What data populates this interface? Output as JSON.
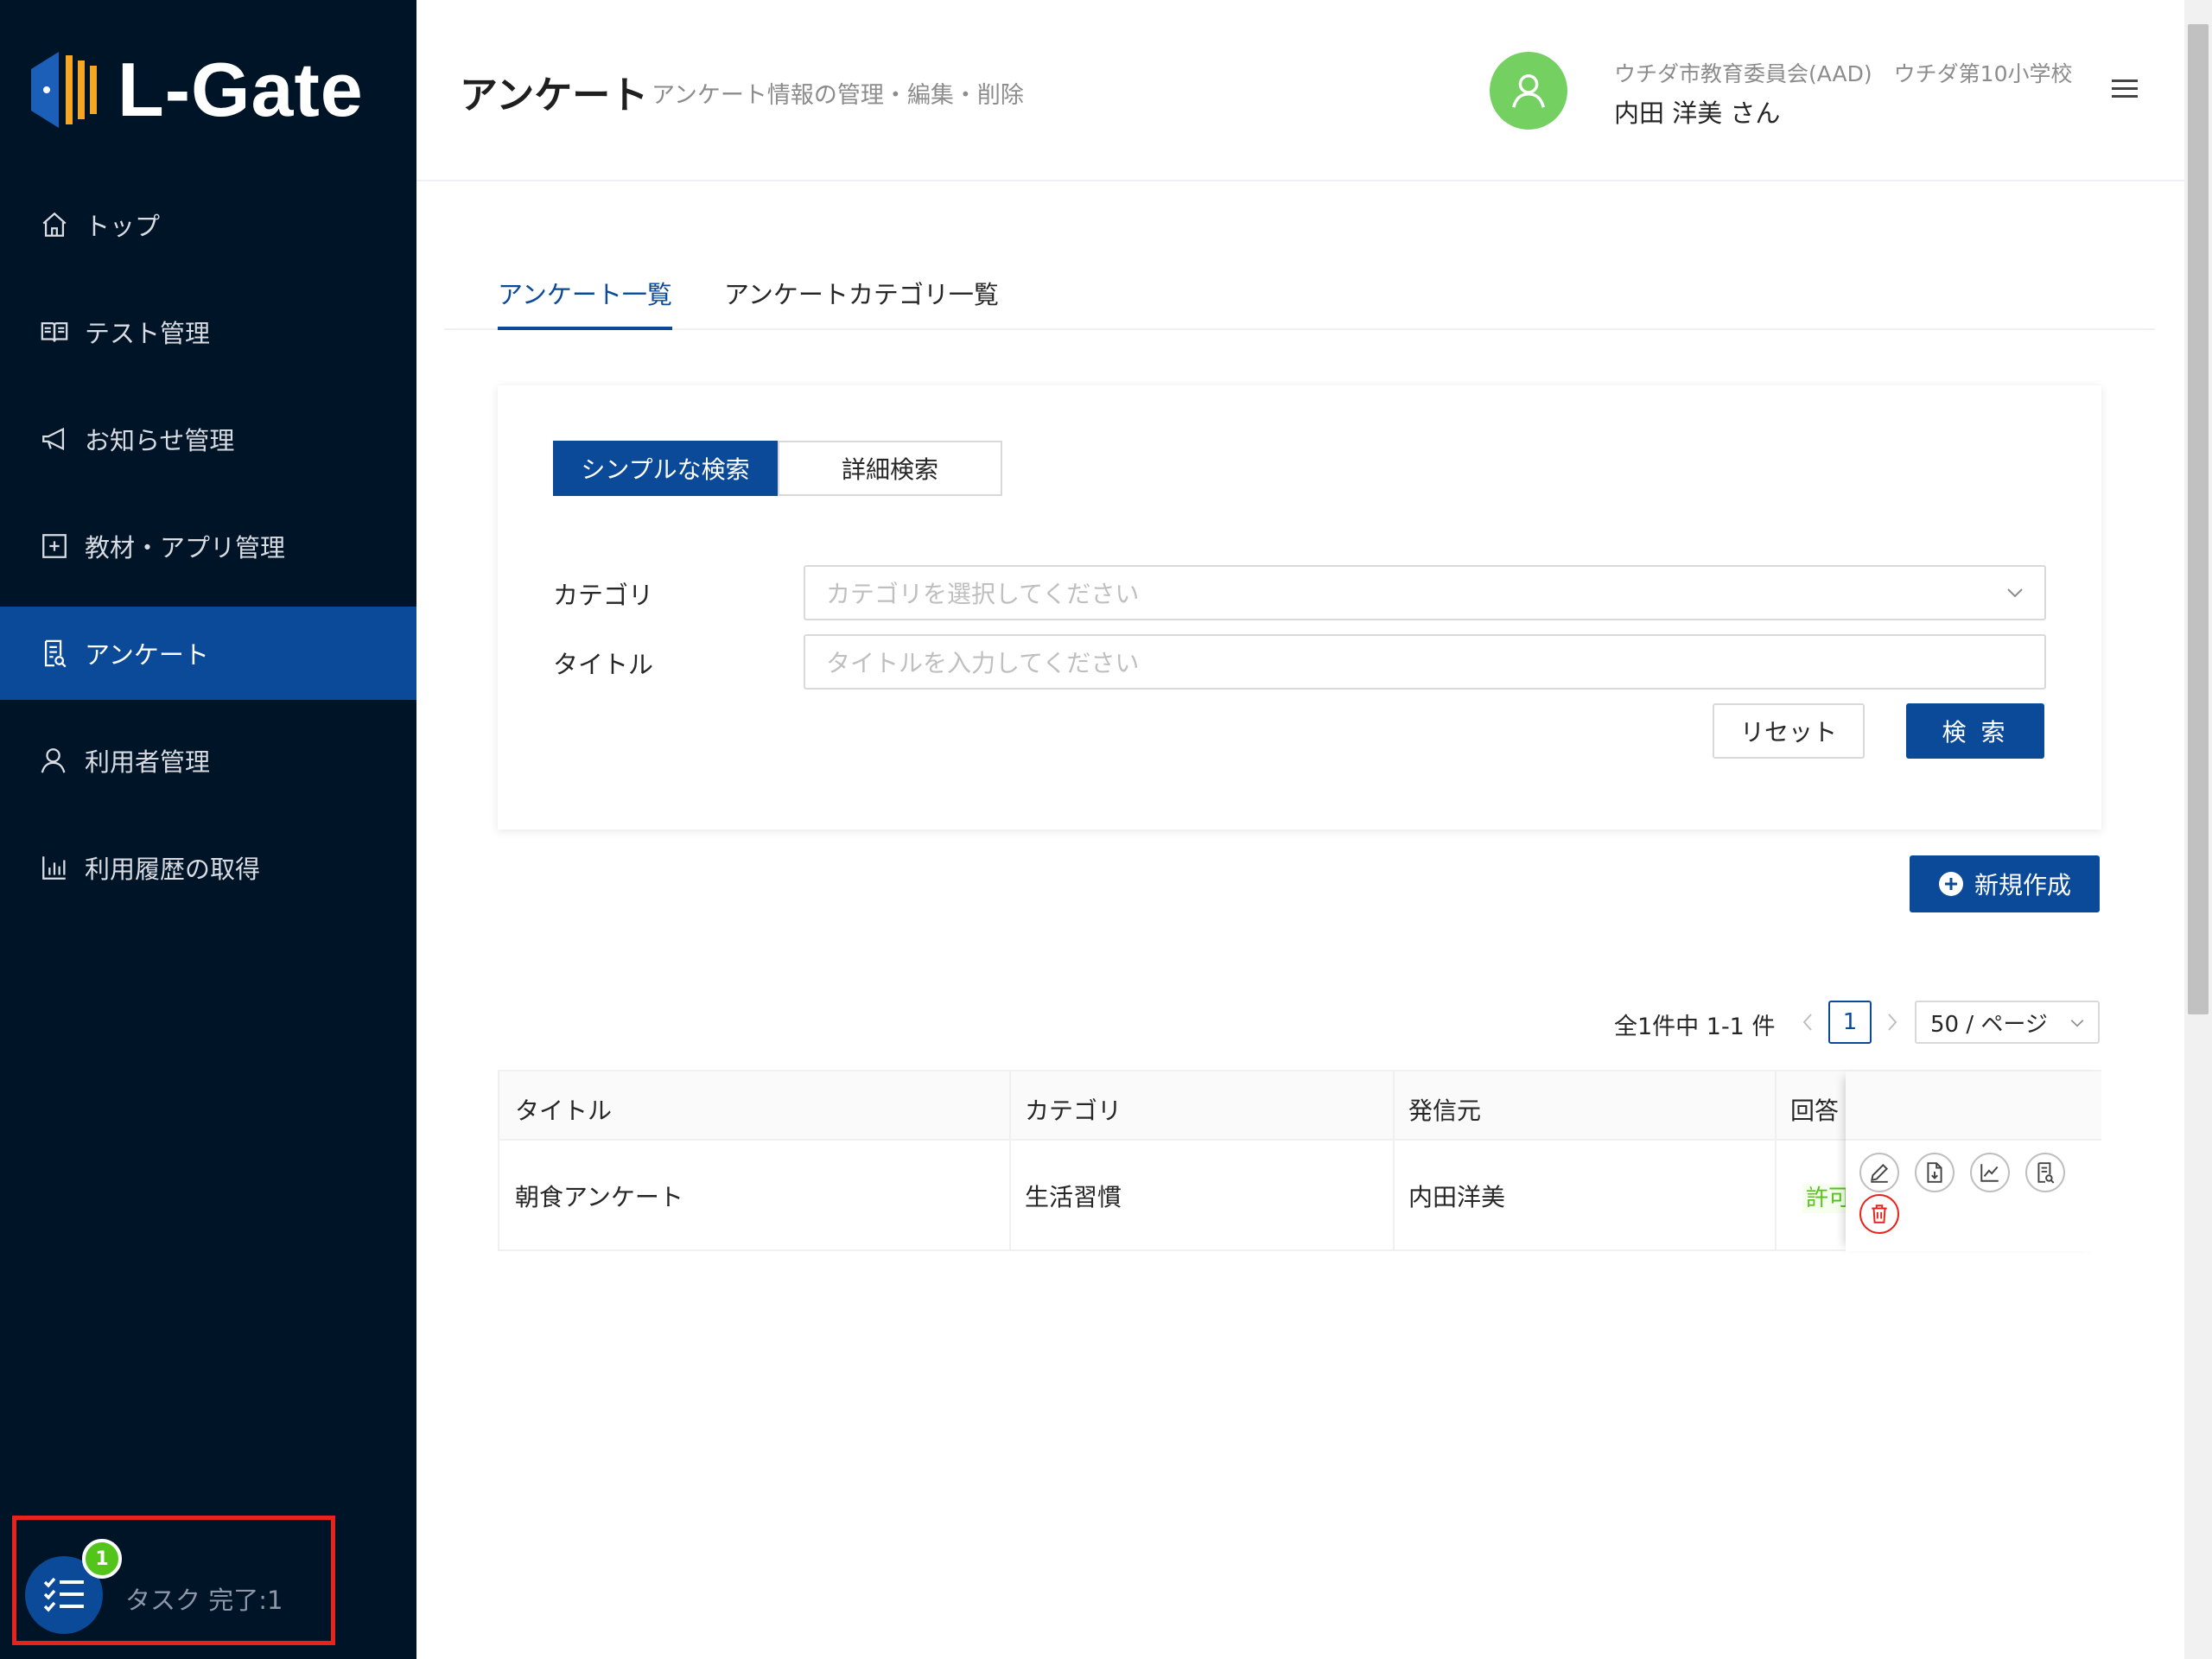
{
  "app": {
    "name": "L-Gate"
  },
  "sidebar": {
    "items": [
      {
        "label": "トップ"
      },
      {
        "label": "テスト管理"
      },
      {
        "label": "お知らせ管理"
      },
      {
        "label": "教材・アプリ管理"
      },
      {
        "label": "アンケート"
      },
      {
        "label": "利用者管理"
      },
      {
        "label": "利用履歴の取得"
      }
    ],
    "active_index": 4,
    "task": {
      "badge": "1",
      "label": "タスク 完了:1"
    }
  },
  "header": {
    "title": "アンケート",
    "subtitle": "アンケート情報の管理・編集・削除",
    "org": "ウチダ市教育委員会(AAD)　ウチダ第10小学校",
    "user": "内田 洋美 さん"
  },
  "tabs": [
    {
      "label": "アンケート一覧",
      "active": true
    },
    {
      "label": "アンケートカテゴリ一覧",
      "active": false
    }
  ],
  "search": {
    "simple_label": "シンプルな検索",
    "detail_label": "詳細検索",
    "category_label": "カテゴリ",
    "category_placeholder": "カテゴリを選択してください",
    "title_label": "タイトル",
    "title_placeholder": "タイトルを入力してください",
    "reset_label": "リセット",
    "search_label": "検 索"
  },
  "new_button": "新規作成",
  "pagination": {
    "total_text": "全1件中 1-1 件",
    "current_page": "1",
    "page_size": "50 / ページ"
  },
  "table": {
    "columns": [
      "タイトル",
      "カテゴリ",
      "発信元",
      "回答"
    ],
    "rows": [
      {
        "title": "朝食アンケート",
        "category": "生活習慣",
        "sender": "内田洋美",
        "answer": "許可"
      }
    ]
  },
  "colors": {
    "sidebar_bg": "#001428",
    "accent": "#0a4a98",
    "avatar": "#73d061",
    "badge": "#52c41a",
    "highlight": "#e8231c"
  }
}
